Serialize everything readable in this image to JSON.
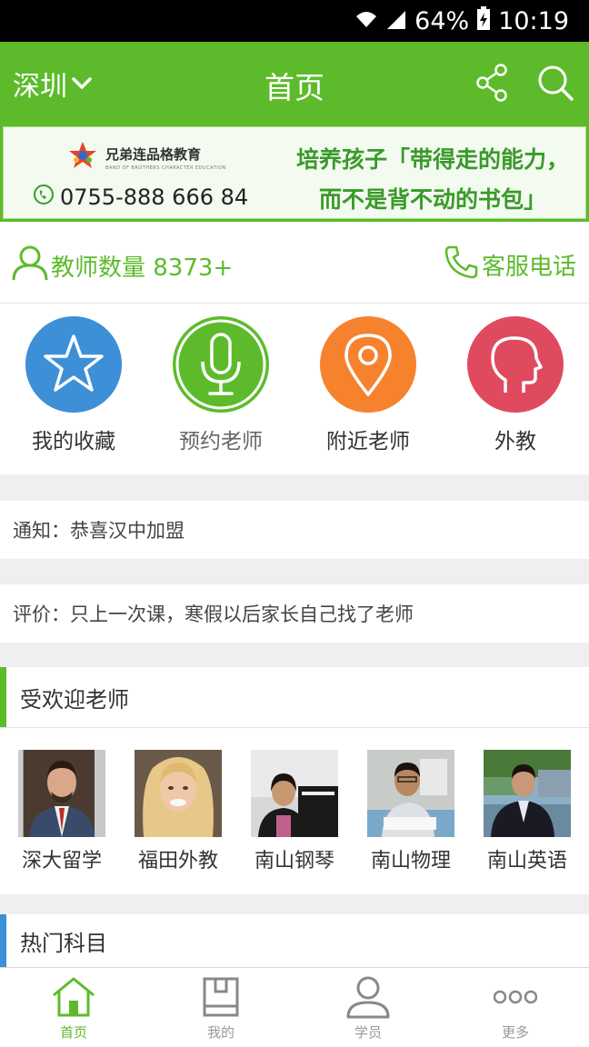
{
  "status_bar": {
    "battery": "64%",
    "time": "10:19"
  },
  "header": {
    "city": "深圳",
    "title": "首页",
    "share_icon": "share-icon",
    "search_icon": "search-icon"
  },
  "banner": {
    "brand_name": "兄弟连品格教育",
    "brand_sub": "BAND OF BROTHERS CHARACTER EDUCATION",
    "phone": "0755-888 666 84",
    "slogan_line1": "培养孩子「带得走的能力，",
    "slogan_line2": "而不是背不动的书包」"
  },
  "stats": {
    "teacher_count": "教师数量 8373+",
    "service_phone": "客服电话"
  },
  "quick_actions": [
    {
      "label": "我的收藏",
      "icon": "star-icon",
      "color": "#3d8fd8"
    },
    {
      "label": "预约老师",
      "icon": "microphone-icon",
      "color": "#5dbb2b"
    },
    {
      "label": "附近老师",
      "icon": "location-pin-icon",
      "color": "#f7822e"
    },
    {
      "label": "外教",
      "icon": "head-profile-icon",
      "color": "#e04a5f"
    }
  ],
  "notices": {
    "notice": "通知：恭喜汉中加盟",
    "review": "评价：只上一次课，寒假以后家长自己找了老师"
  },
  "popular_teachers": {
    "title": "受欢迎老师",
    "items": [
      {
        "name": "深大留学"
      },
      {
        "name": "福田外教"
      },
      {
        "name": "南山钢琴"
      },
      {
        "name": "南山物理"
      },
      {
        "name": "南山英语"
      }
    ]
  },
  "hot_subjects": {
    "title": "热门科目"
  },
  "bottom_nav": [
    {
      "label": "首页",
      "icon": "home-icon",
      "active": true
    },
    {
      "label": "我的",
      "icon": "book-icon",
      "active": false
    },
    {
      "label": "学员",
      "icon": "person-icon",
      "active": false
    },
    {
      "label": "更多",
      "icon": "more-dots-icon",
      "active": false
    }
  ],
  "colors": {
    "primary": "#5dbb2b",
    "blue_accent": "#3d8fd8"
  }
}
